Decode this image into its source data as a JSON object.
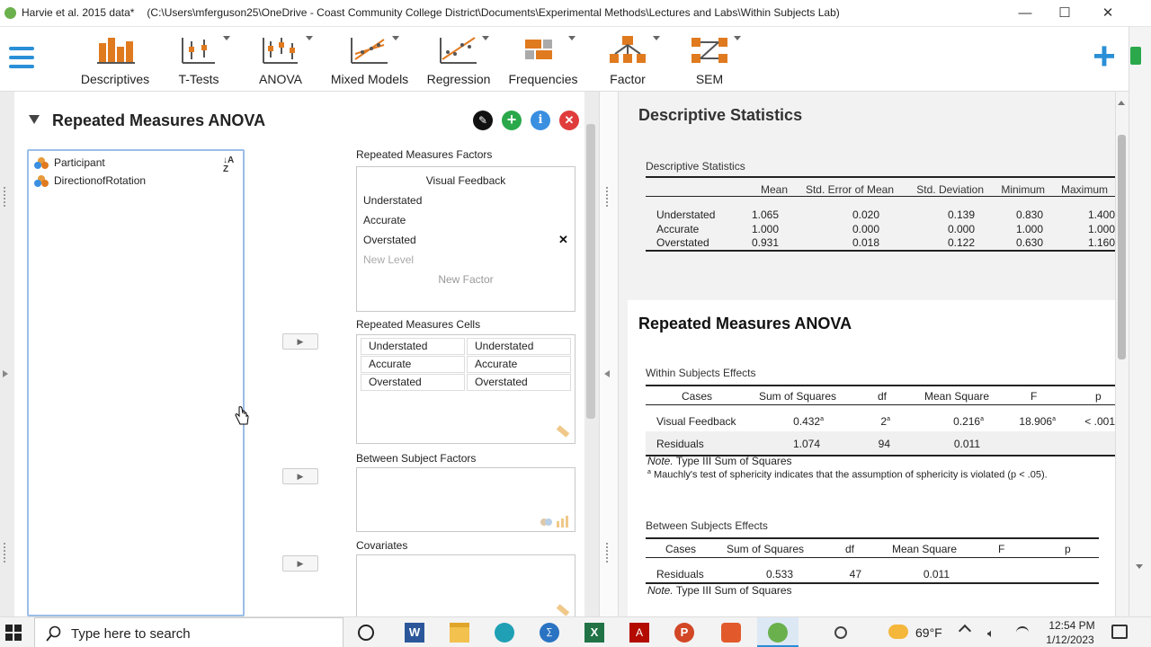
{
  "window": {
    "app_name": "Harvie et al. 2015 data*",
    "path": "(C:\\Users\\mferguson25\\OneDrive - Coast Community College District\\Documents\\Experimental Methods\\Lectures and Labs\\Within Subjects Lab)",
    "minimize": "—",
    "maximize": "☐",
    "close": "✕"
  },
  "ribbon": {
    "items": [
      {
        "label": "Descriptives",
        "icon": "bar-chart-icon"
      },
      {
        "label": "T-Tests",
        "icon": "ttest-icon"
      },
      {
        "label": "ANOVA",
        "icon": "anova-icon"
      },
      {
        "label": "Mixed Models",
        "icon": "mixed-models-icon"
      },
      {
        "label": "Regression",
        "icon": "regression-icon"
      },
      {
        "label": "Frequencies",
        "icon": "frequencies-icon"
      },
      {
        "label": "Factor",
        "icon": "factor-icon"
      },
      {
        "label": "SEM",
        "icon": "sem-icon"
      }
    ],
    "plus": "+"
  },
  "analysis": {
    "title": "Repeated Measures ANOVA",
    "variables": [
      "Participant",
      "DirectionofRotation"
    ],
    "sort_icon": "↓A Z",
    "rm_factors_label": "Repeated Measures Factors",
    "factor_name": "Visual Feedback",
    "levels": [
      "Understated",
      "Accurate",
      "Overstated"
    ],
    "new_level": "New Level",
    "new_factor": "New Factor",
    "rm_cells_label": "Repeated Measures Cells",
    "cells": [
      [
        "Understated",
        "Understated"
      ],
      [
        "Accurate",
        "Accurate"
      ],
      [
        "Overstated",
        "Overstated"
      ]
    ],
    "between_label": "Between Subject Factors",
    "covariates_label": "Covariates",
    "remove_mark": "✕",
    "arrow": "▶"
  },
  "results": {
    "desc_heading": "Descriptive Statistics",
    "desc_table_title": "Descriptive Statistics",
    "desc_headers": [
      "",
      "Mean",
      "Std. Error of Mean",
      "Std. Deviation",
      "Minimum",
      "Maximum"
    ],
    "desc_rows": [
      [
        "Understated",
        "1.065",
        "0.020",
        "0.139",
        "0.830",
        "1.400"
      ],
      [
        "Accurate",
        "1.000",
        "0.000",
        "0.000",
        "1.000",
        "1.000"
      ],
      [
        "Overstated",
        "0.931",
        "0.018",
        "0.122",
        "0.630",
        "1.160"
      ]
    ],
    "rm_heading": "Repeated Measures ANOVA",
    "within_title": "Within Subjects Effects",
    "within_headers": [
      "Cases",
      "Sum of Squares",
      "df",
      "Mean Square",
      "F",
      "p"
    ],
    "within_rows": [
      [
        "Visual Feedback",
        "0.432",
        "2",
        "0.216",
        "18.906",
        "< .001"
      ],
      [
        "Residuals",
        "1.074",
        "94",
        "0.011",
        "",
        ""
      ]
    ],
    "sup": "a",
    "note_label": "Note.",
    "note_text": "Type III Sum of Squares",
    "footnote": "Mauchly's test of sphericity indicates that the assumption of sphericity is violated (p < .05).",
    "between_title": "Between Subjects Effects",
    "between_headers": [
      "Cases",
      "Sum of Squares",
      "df",
      "Mean Square",
      "F",
      "p"
    ],
    "between_rows": [
      [
        "Residuals",
        "0.533",
        "47",
        "0.011",
        "",
        ""
      ]
    ],
    "note2_text": "Type III Sum of Squares"
  },
  "taskbar": {
    "search_placeholder": "Type here to search",
    "weather": "69°F",
    "time": "12:54 PM",
    "date": "1/12/2023"
  },
  "colors": {
    "accent": "#2a8fd6",
    "jasp_orange": "#e07a1f",
    "jasp_green": "#2aa84a",
    "info_blue": "#3a8fe0",
    "close_red": "#e03c3c"
  }
}
